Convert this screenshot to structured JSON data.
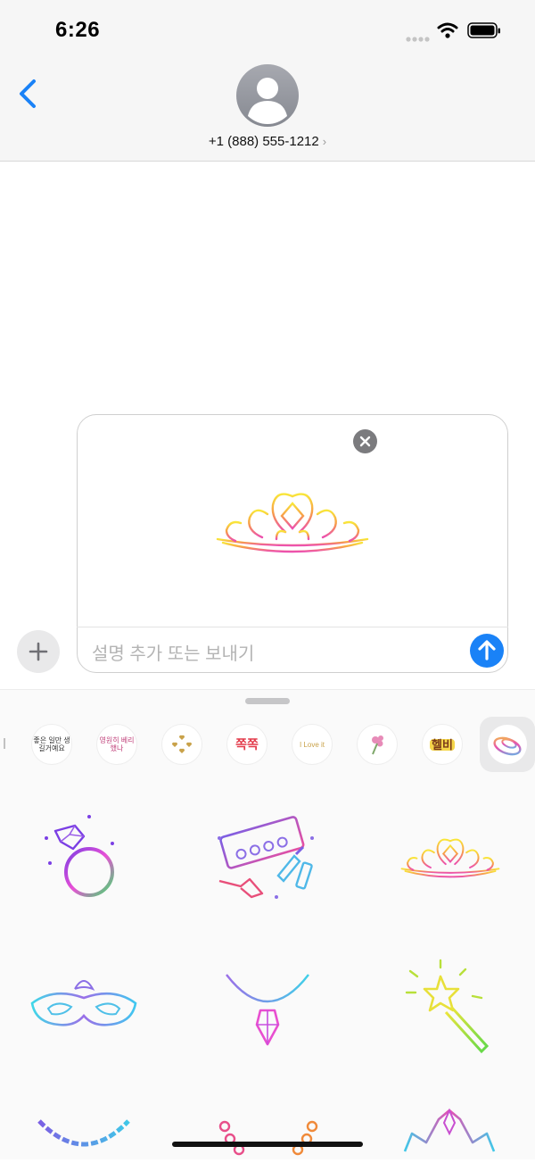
{
  "status_bar": {
    "time": "6:26"
  },
  "header": {
    "contact_number": "+1 (888) 555-1212"
  },
  "compose": {
    "placeholder": "설명 추가 또는 보내기"
  },
  "tray": {
    "items": [
      {
        "label": "좋은 일만 생길거예요"
      },
      {
        "label": "영원히 베리했나"
      },
      {
        "label": ""
      },
      {
        "label": "쪽쪽"
      },
      {
        "label": "I Love it"
      },
      {
        "label": ""
      },
      {
        "label": "헬비"
      }
    ]
  },
  "colors": {
    "accent": "#1a82f7"
  }
}
